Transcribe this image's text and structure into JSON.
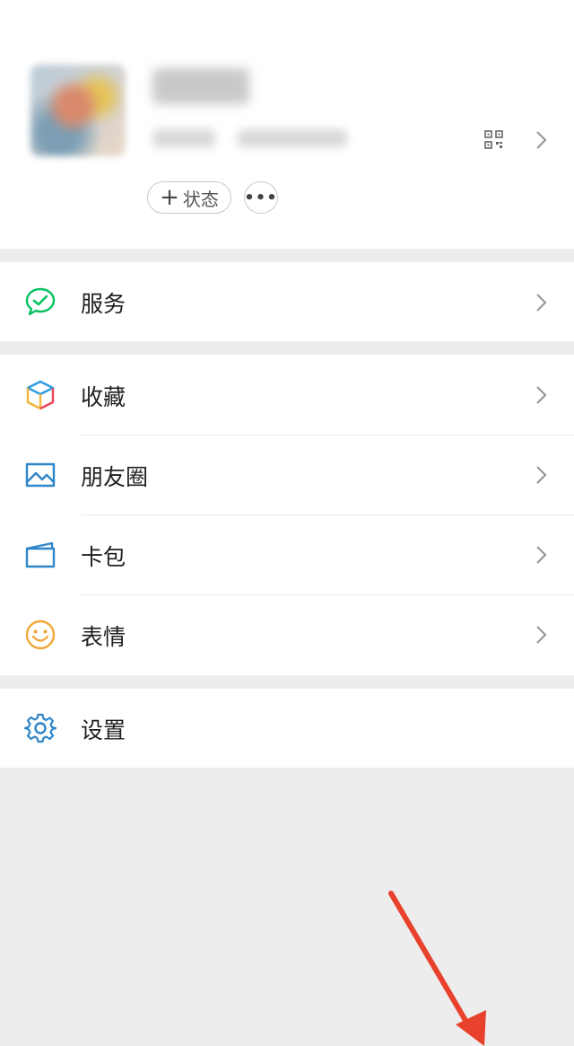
{
  "profile": {
    "status_label": "状态",
    "status_plus": "+",
    "more_label": "•••"
  },
  "menu": {
    "services": "服务",
    "favorites": "收藏",
    "moments": "朋友圈",
    "cards": "卡包",
    "stickers": "表情",
    "settings": "设置"
  },
  "colors": {
    "accent_green": "#07c160",
    "annotation_arrow": "#e8412c"
  },
  "icons": {
    "services": "chat-check-icon",
    "favorites": "cube-icon",
    "moments": "picture-icon",
    "cards": "wallet-icon",
    "stickers": "smile-icon",
    "settings": "gear-icon"
  }
}
